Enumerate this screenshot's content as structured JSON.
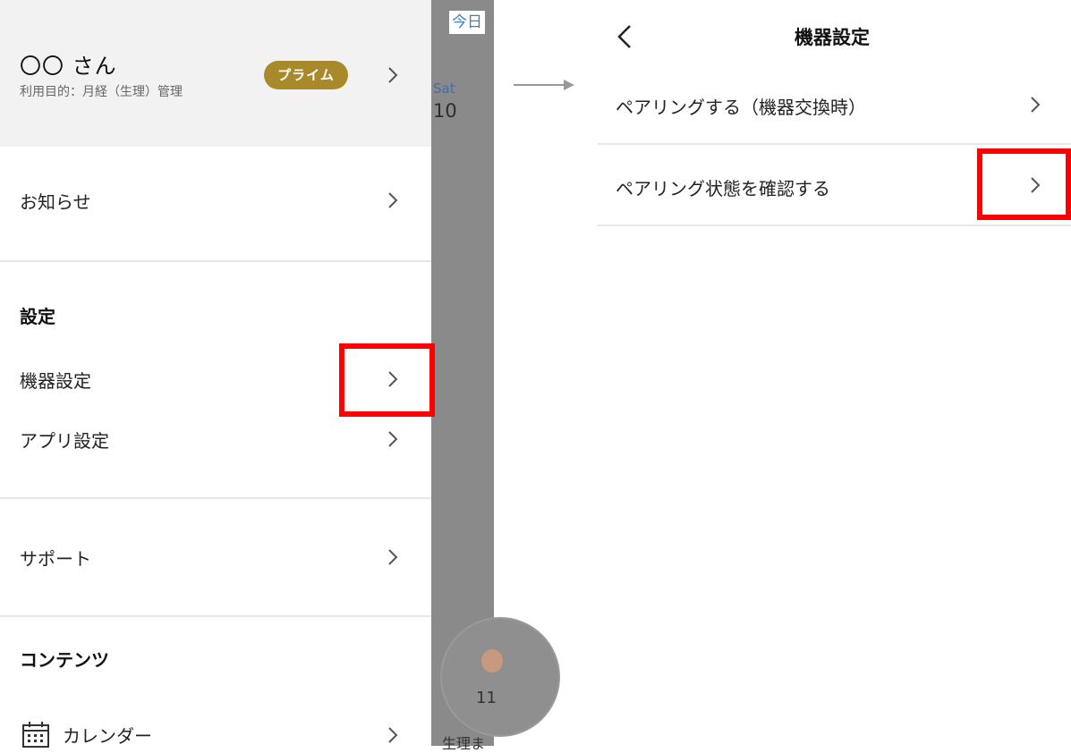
{
  "drawer": {
    "user_name": "〇〇 さん",
    "user_purpose": "利用目的：月経（生理）管理",
    "badge": "プライム",
    "notifications_label": "お知らせ",
    "settings_section": "設定",
    "device_settings_label": "機器設定",
    "app_settings_label": "アプリ設定",
    "support_label": "サポート",
    "contents_section": "コンテンツ",
    "calendar_label": "カレンダー"
  },
  "background_screen": {
    "today_button": "今日",
    "weekday": "Sat",
    "day_number": "10",
    "cycle_day": "11",
    "period_text": "生理ま"
  },
  "device_settings_screen": {
    "title": "機器設定",
    "items": [
      {
        "label": "ペアリングする（機器交換時）"
      },
      {
        "label": "ペアリング状態を確認する"
      }
    ]
  },
  "icons": {
    "chevron": "chevron-right-icon",
    "back": "chevron-left-icon",
    "calendar": "calendar-icon",
    "arrow": "arrow-right-icon"
  },
  "colors": {
    "badge_bg": "#a88a2a",
    "highlight": "#ff0000",
    "today_text": "#3d7fc6",
    "header_bg": "#f2f2f2",
    "overlay": "#8a8a8a"
  }
}
